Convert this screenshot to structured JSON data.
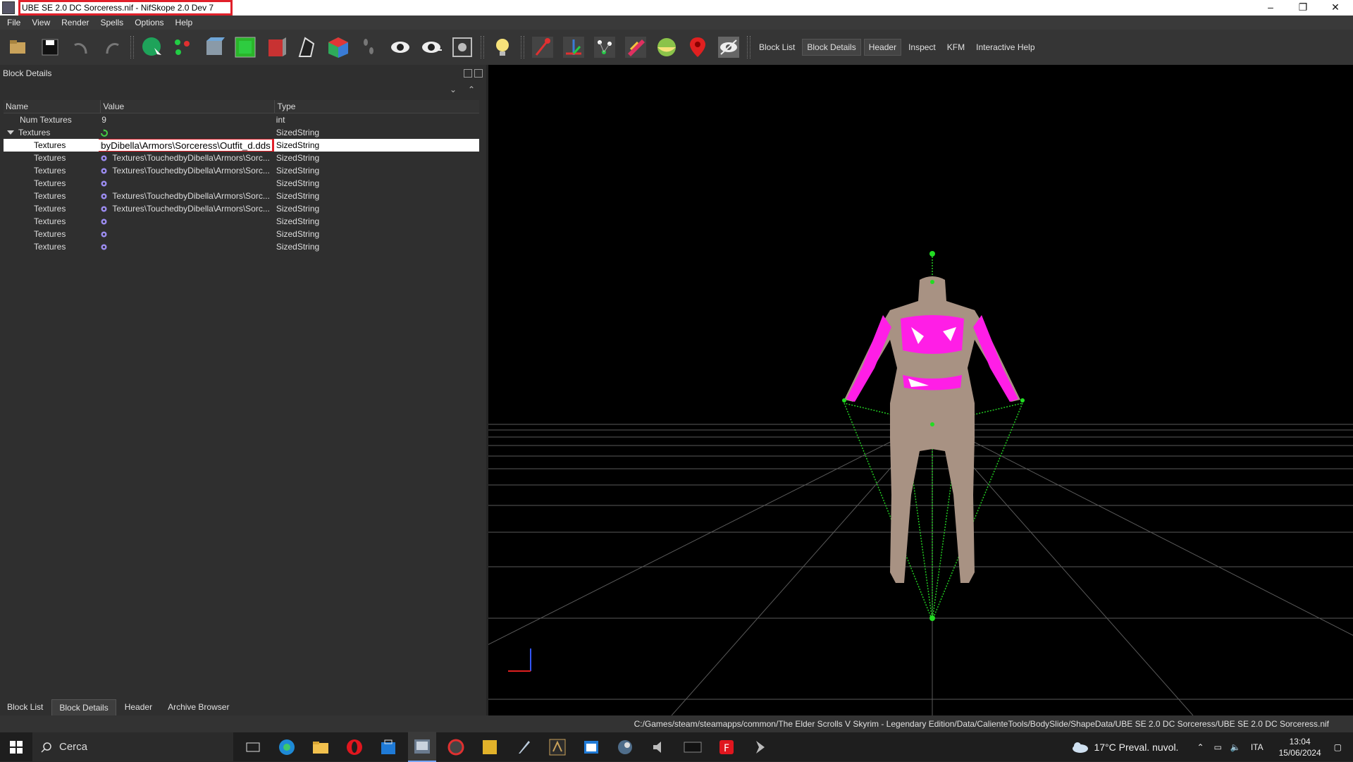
{
  "window": {
    "title": "UBE SE 2.0 DC Sorceress.nif - NifSkope 2.0 Dev 7",
    "minimize": "–",
    "maximize": "❐",
    "close": "✕"
  },
  "menu": [
    "File",
    "View",
    "Render",
    "Spells",
    "Options",
    "Help"
  ],
  "toolbar": {
    "text_buttons": [
      "Block List",
      "Block Details",
      "Header",
      "Inspect",
      "KFM",
      "Interactive Help"
    ]
  },
  "dock": {
    "title": "Block Details",
    "columns": [
      "Name",
      "Value",
      "Type"
    ],
    "rows": [
      {
        "name": "Num Textures",
        "value": "9",
        "type": "int"
      },
      {
        "name": "Textures",
        "value": "",
        "type": "SizedString"
      },
      {
        "name": "Textures",
        "value": "Textures\\TouchedbyDibella\\Armors\\Sorceress\\Outfit_d.dds",
        "type": "SizedString"
      },
      {
        "name": "Textures",
        "value": "Textures\\TouchedbyDibella\\Armors\\Sorc...",
        "type": "SizedString"
      },
      {
        "name": "Textures",
        "value": "Textures\\TouchedbyDibella\\Armors\\Sorc...",
        "type": "SizedString"
      },
      {
        "name": "Textures",
        "value": "",
        "type": "SizedString"
      },
      {
        "name": "Textures",
        "value": "Textures\\TouchedbyDibella\\Armors\\Sorc...",
        "type": "SizedString"
      },
      {
        "name": "Textures",
        "value": "Textures\\TouchedbyDibella\\Armors\\Sorc...",
        "type": "SizedString"
      },
      {
        "name": "Textures",
        "value": "",
        "type": "SizedString"
      },
      {
        "name": "Textures",
        "value": "",
        "type": "SizedString"
      },
      {
        "name": "Textures",
        "value": "",
        "type": "SizedString"
      }
    ],
    "tabs": [
      "Block List",
      "Block Details",
      "Header",
      "Archive Browser"
    ]
  },
  "status": {
    "path": "C:/Games/steam/steamapps/common/The Elder Scrolls V Skyrim - Legendary Edition/Data/CalienteTools/BodySlide/ShapeData/UBE SE 2.0 DC Sorceress/UBE SE 2.0 DC Sorceress.nif"
  },
  "taskbar": {
    "search_placeholder": "Cerca",
    "weather": "17°C  Preval. nuvol.",
    "lang": "ITA",
    "time": "13:04",
    "date": "15/06/2024"
  },
  "colors": {
    "highlight": "#e0202a",
    "outfit": "#ff1ee6",
    "bones": "#22dd22"
  }
}
